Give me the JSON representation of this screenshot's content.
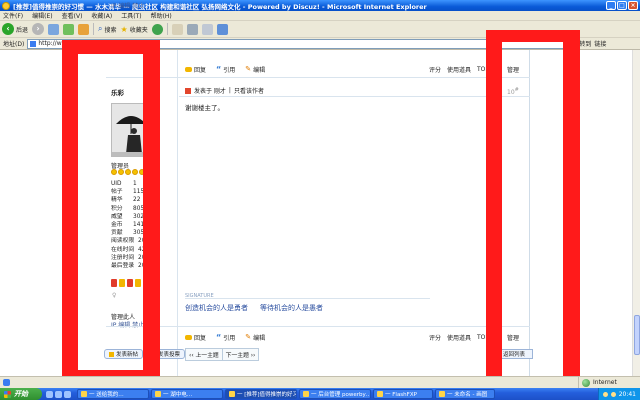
{
  "window": {
    "title": "[推荐]值得推崇的好习惯 — 水木清华 — 爬虫社区 构建和谐社区 弘扬网络文化 - Powered by Discuz! - Microsoft Internet Explorer",
    "minimize": "_",
    "maximize": "□",
    "close": "×"
  },
  "menu": [
    "文件(F)",
    "编辑(E)",
    "查看(V)",
    "收藏(A)",
    "工具(T)",
    "帮助(H)"
  ],
  "toolbar": {
    "back": "后退",
    "search": "搜索",
    "favorites": "收藏夹"
  },
  "address": {
    "label": "地址(D)",
    "url": "http://www.515          extra=page%3D1",
    "go": "转到",
    "links": "链接"
  },
  "post": {
    "top_ip_line": "IP 编辑 禁止",
    "actions": {
      "reply": "回复",
      "quote": "引用",
      "edit": "编辑"
    },
    "tools": {
      "rate": "评分",
      "tools": "使用道具",
      "top": "TOP",
      "manage": "管理"
    },
    "author": {
      "name": "乐彩",
      "rank": "管理员",
      "stats": [
        {
          "k": "UID",
          "v": "1"
        },
        {
          "k": "帖子",
          "v": "1150"
        },
        {
          "k": "精华",
          "v": "22"
        },
        {
          "k": "积分",
          "v": "8052"
        },
        {
          "k": "威望",
          "v": "3023"
        },
        {
          "k": "金币",
          "v": "1410"
        },
        {
          "k": "贡献",
          "v": "3051"
        },
        {
          "k": "阅读权限",
          "v": "200"
        },
        {
          "k": "在线时间",
          "v": "428"
        },
        {
          "k": "注册时间",
          "v": "200"
        },
        {
          "k": "最后登录",
          "v": "200"
        }
      ],
      "admin_line": "管理此人",
      "bottom_ip_line": "IP 编辑 禁止"
    },
    "meta": {
      "posted_on": "发表于 刚才",
      "only_author": "只看该作者"
    },
    "floor": "10",
    "floor_sup": "#",
    "body": "谢谢楼主了。",
    "signature_label": "SIGNATURE",
    "signature": [
      "创造机会的人是勇者",
      "等待机会的人是愚者"
    ],
    "nav": [
      "‹‹ 上一主题",
      "下一主题 ››"
    ],
    "new_thread": "发表新帖",
    "new_poll": "发表投票",
    "back_to_list": "返回列表"
  },
  "status": {
    "zone": "Internet"
  },
  "taskbar": {
    "start": "开始",
    "tasks": [
      "一 送给我的…",
      "一 湖中电…",
      "一 [推荐]值得推崇的好习惯",
      "一 后台管理 powerby…",
      "一 FlashFXP",
      "一 未命名 - 画图"
    ],
    "clock": "20:41"
  }
}
